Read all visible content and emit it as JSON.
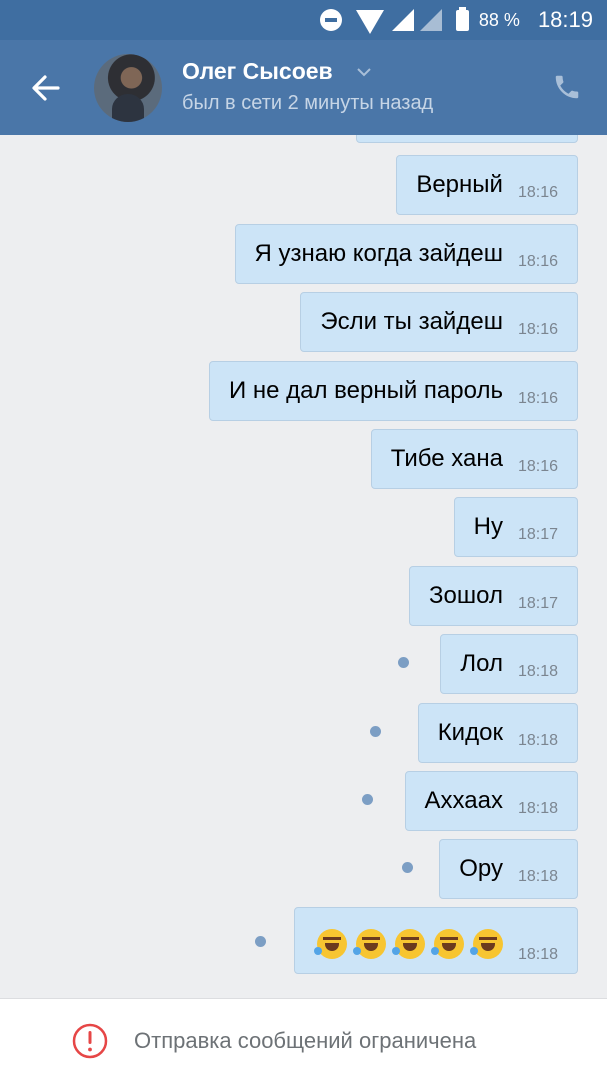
{
  "statusbar": {
    "battery": "88 %",
    "time": "18:19"
  },
  "header": {
    "name": "Олег Сысоев",
    "status": "был в сети 2 минуты назад"
  },
  "messages": [
    {
      "text": "Верный",
      "time": "18:16"
    },
    {
      "text": "Я узнаю когда зайдеш",
      "time": "18:16"
    },
    {
      "text": "Эсли ты зайдеш",
      "time": "18:16"
    },
    {
      "text": "И не дал верный пароль",
      "time": "18:16"
    },
    {
      "text": "Тибе хана",
      "time": "18:16"
    },
    {
      "text": "Ну",
      "time": "18:17"
    },
    {
      "text": "Зошол",
      "time": "18:17"
    },
    {
      "text": "Лол",
      "time": "18:18"
    },
    {
      "text": "Кидок",
      "time": "18:18"
    },
    {
      "text": "Аххаах",
      "time": "18:18"
    },
    {
      "text": "Ору",
      "time": "18:18"
    },
    {
      "emoji": "rolling-on-floor-laughing",
      "emoji_count": 5,
      "time": "18:18"
    }
  ],
  "footer": {
    "text": "Отправка сообщений ограничена"
  },
  "colors": {
    "header": "#4a76a8",
    "statusbar": "#3f6ea1",
    "bubble": "#cce4f7",
    "background": "#edeef0",
    "alert": "#e64646"
  }
}
